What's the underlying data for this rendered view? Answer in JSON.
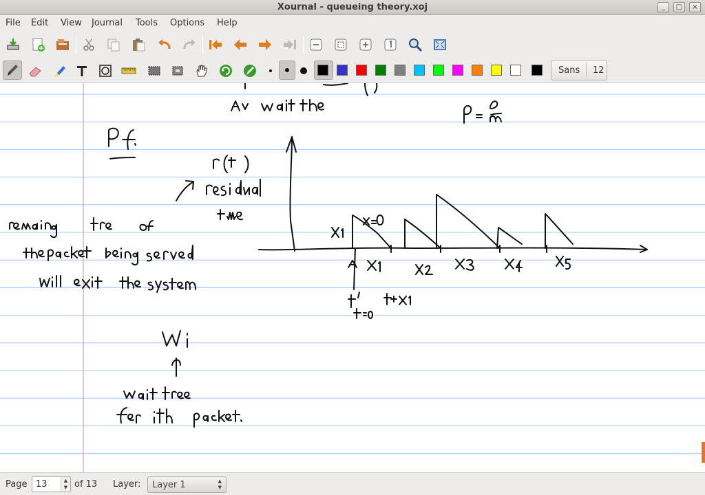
{
  "window": {
    "title": "Xournal - queueing theory.xoj"
  },
  "window_controls": {
    "minimize": "_",
    "maximize": "□",
    "close": "×"
  },
  "menu": [
    "File",
    "Edit",
    "View",
    "Journal",
    "Tools",
    "Options",
    "Help"
  ],
  "toolbar": {
    "file_tools": [
      "save-icon",
      "new-page-icon",
      "open-icon"
    ],
    "edit_tools": [
      "cut-icon",
      "copy-icon",
      "paste-icon",
      "undo-icon",
      "redo-icon"
    ],
    "nav_tools": [
      "first-page-icon",
      "previous-page-icon",
      "next-page-icon",
      "last-page-icon"
    ],
    "zoom_tools": [
      "zoom-out-icon",
      "zoom-fit-icon",
      "zoom-in-icon",
      "zoom-100-icon",
      "find-icon",
      "fullscreen-icon"
    ]
  },
  "palette": {
    "colors": [
      "#000000",
      "#3333cc",
      "#ff0000",
      "#008000",
      "#808080",
      "#00c0ff",
      "#00ff00",
      "#ff00ff",
      "#ff8000",
      "#ffff00",
      "#ffffff"
    ],
    "current_color": "#000000"
  },
  "font": {
    "name": "Sans",
    "size": "12"
  },
  "status": {
    "page_label": "Page",
    "page_value": "13",
    "of_label": "of 13",
    "layer_label": "Layer:",
    "layer_value": "Layer 1"
  },
  "document": {
    "ruling_color": "#a0c8ff",
    "margin_color": "#d0a0b0"
  }
}
